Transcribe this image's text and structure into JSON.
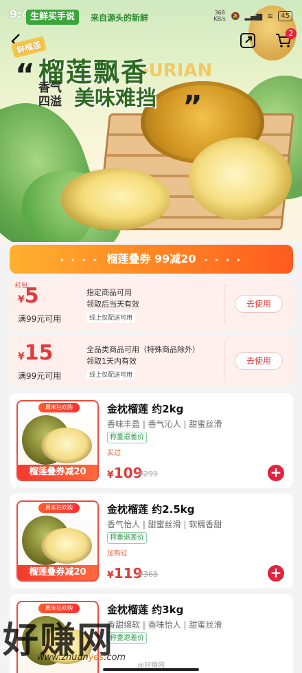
{
  "status": {
    "time": "9:48",
    "net_speed_value": "368",
    "net_speed_unit": "KB/s",
    "battery": "45"
  },
  "brand": {
    "name": "生鲜买手说",
    "slogan": "来自源头的新鲜"
  },
  "header": {
    "cart_count": "2"
  },
  "hero": {
    "ribbon": "鲜榴莲",
    "title": "榴莲飘香",
    "title_en": "DURIAN",
    "sub_small": "香气四溢",
    "sub_big": "美味难挡",
    "quote_open": "“",
    "quote_close": "”"
  },
  "stack_banner": {
    "dots": "• • • •",
    "label": "榴莲叠券 99减20"
  },
  "coupons": [
    {
      "corner": "红包",
      "currency": "¥",
      "amount": "5",
      "condition": "满99元可用",
      "line1": "指定商品可用",
      "line2": "领取后当天有效",
      "line3": "线上仅配送可用",
      "button": "去使用"
    },
    {
      "corner": "",
      "currency": "¥",
      "amount": "15",
      "condition": "满99元可用",
      "line1": "全品类商品可用（特殊商品除外）",
      "line2": "领取1天内有效",
      "line3": "线上仅配送可用",
      "button": "去使用"
    }
  ],
  "products": [
    {
      "promo_top": "周末狂欢购",
      "promo_bottom": "榴莲叠券减20",
      "name": "金枕榴莲 约2kg",
      "features": "香味丰盈 | 香气沁人 | 甜蜜丝滑",
      "tag": "称重退差价",
      "status": "买过",
      "currency": "¥",
      "price": "109",
      "original": "¥299"
    },
    {
      "promo_top": "周末狂欢购",
      "promo_bottom": "榴莲叠券减20",
      "name": "金枕榴莲 约2.5kg",
      "features": "香气怡人 | 甜蜜丝滑 | 软糯香甜",
      "tag": "称重退差价",
      "status": "加购过",
      "currency": "¥",
      "price": "119",
      "original": "¥368"
    },
    {
      "promo_top": "周末狂欢购",
      "promo_bottom": "",
      "name": "金枕榴莲 约3kg",
      "features": "香甜绵软 | 香味怡人 | 甜蜜丝滑",
      "tag": "称重退差价",
      "status": "",
      "currency": "",
      "price": "",
      "original": ""
    }
  ],
  "watermark": {
    "text": "好赚网",
    "url_prefix": "www.zhuan",
    "url_mid": "yes",
    "url_suffix": ".com",
    "weibo": "@好赚网"
  },
  "colors": {
    "accent_red": "#e23b3b",
    "banner_orange": "#ff7f22",
    "brand_green": "#3aa63a"
  }
}
